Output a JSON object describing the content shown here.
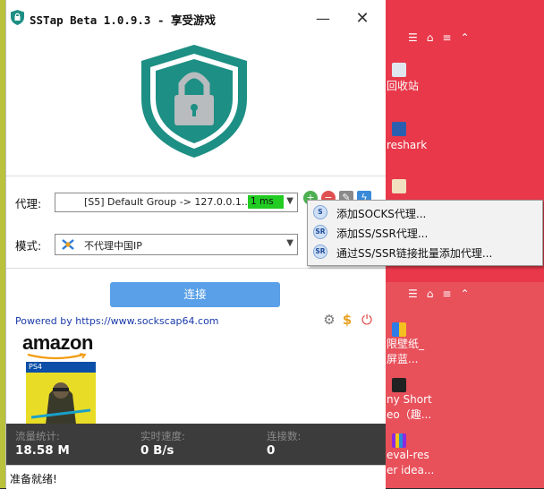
{
  "window": {
    "title": "SSTap Beta 1.0.9.3 - 享受游戏",
    "minimize": "—",
    "close": "✕"
  },
  "proxy": {
    "label": "代理:",
    "selected": "[S5] Default Group -> 127.0.0.1...",
    "ping": "1 ms"
  },
  "mode": {
    "label": "模式:",
    "selected": "不代理中国IP"
  },
  "connect_button": "连接",
  "powered_by": "Powered by https://www.sockscap64.com",
  "ad": {
    "brand": "amazon",
    "platform": "PS4"
  },
  "stats": {
    "traffic_label": "流量统计:",
    "traffic_value": "18.58 M",
    "speed_label": "实时速度:",
    "speed_value": "0 B/s",
    "connections_label": "连接数:",
    "connections_value": "0"
  },
  "status": "准备就绪!",
  "context_menu": {
    "items": [
      {
        "icon": "S",
        "label": "添加SOCKS代理..."
      },
      {
        "icon": "SR",
        "label": "添加SS/SSR代理..."
      },
      {
        "icon": "SR",
        "label": "通过SS/SSR链接批量添加代理..."
      }
    ]
  },
  "desktop": {
    "icons": [
      {
        "label": "回收站"
      },
      {
        "label": "reshark"
      },
      {
        "label": "限壁纸_"
      },
      {
        "label": "屏蓝..."
      },
      {
        "label": "ny Short"
      },
      {
        "label": "eo（趣..."
      },
      {
        "label": "eval-res"
      },
      {
        "label": "er idea..."
      }
    ],
    "tray_icons": [
      "list-icon",
      "lock-icon",
      "menu-icon",
      "chevron-up-icon"
    ]
  },
  "colors": {
    "accent": "#5aa0e8",
    "shield_teal": "#1d8f84",
    "ping_green": "#22cc22",
    "stats_bg": "#3c3c3c"
  }
}
